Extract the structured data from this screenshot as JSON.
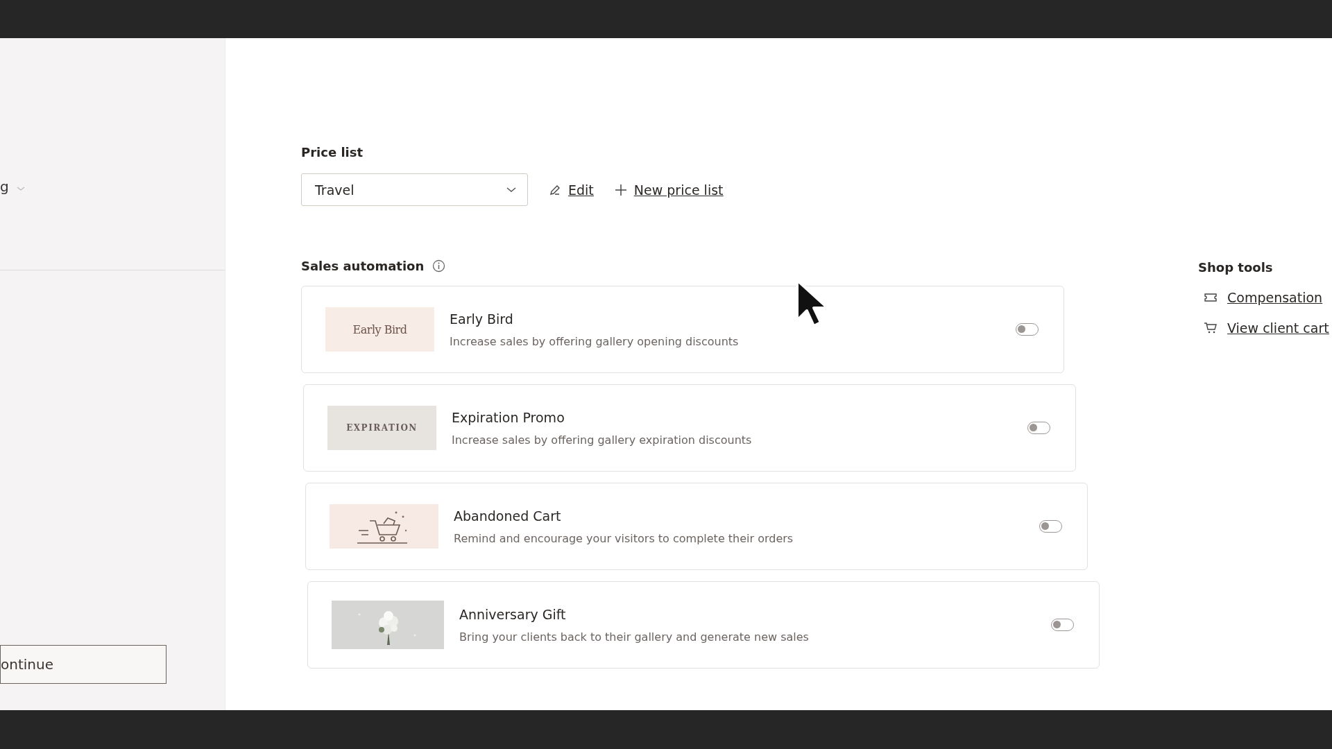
{
  "sidebar": {
    "menu_label": "g",
    "continue_button": "ontinue"
  },
  "price_list": {
    "label": "Price list",
    "value": "Travel",
    "edit": "Edit",
    "new": "New price list"
  },
  "sales_automation": {
    "title": "Sales automation",
    "items": [
      {
        "kind": "early",
        "cover_text": "Early Bird",
        "title": "Early Bird",
        "description": "Increase sales by offering gallery opening discounts",
        "on": false
      },
      {
        "kind": "expiration",
        "cover_text": "EXPIRATION",
        "title": "Expiration Promo",
        "description": "Increase sales by offering gallery expiration discounts",
        "on": false
      },
      {
        "kind": "cart",
        "title": "Abandoned Cart",
        "description": "Remind and encourage your visitors to complete their orders",
        "on": false
      },
      {
        "kind": "gift",
        "title": "Anniversary Gift",
        "description": "Bring your clients back to their gallery and generate new sales",
        "on": false
      }
    ]
  },
  "shop_tools": {
    "title": "Shop tools",
    "links": [
      {
        "kind": "ticket",
        "label": "Compensation"
      },
      {
        "kind": "cart",
        "label": "View client cart"
      }
    ]
  }
}
